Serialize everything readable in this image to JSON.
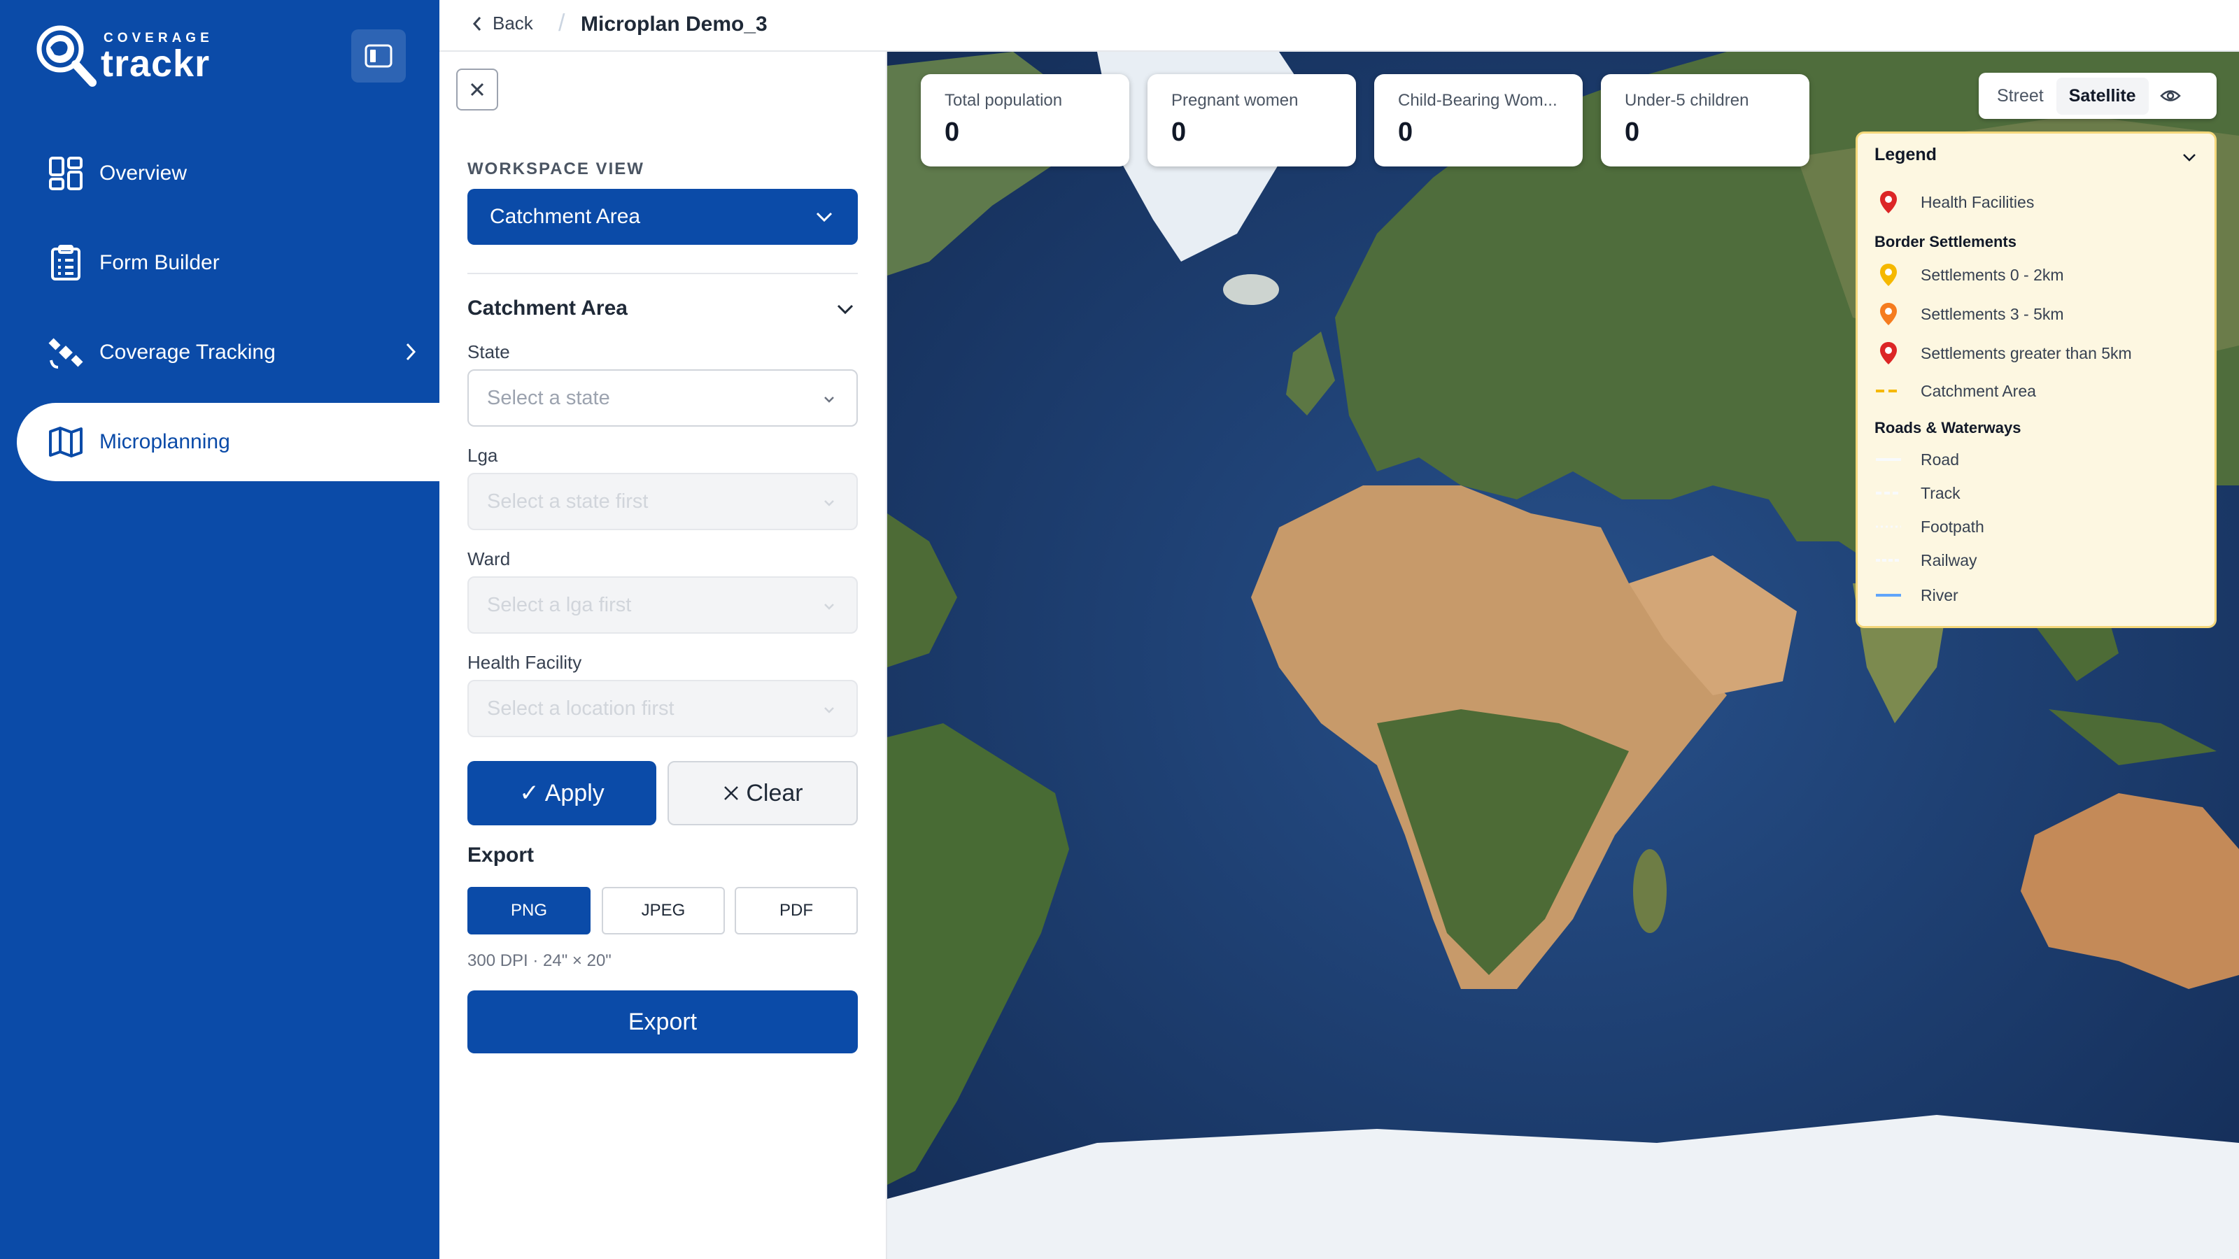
{
  "app": {
    "logo_small": "COVERAGE",
    "logo_big": "trackr"
  },
  "sidebar": {
    "items": [
      {
        "label": "Overview"
      },
      {
        "label": "Form Builder"
      },
      {
        "label": "Coverage Tracking"
      },
      {
        "label": "Microplanning"
      }
    ],
    "active": "Microplanning"
  },
  "header": {
    "back_label": "Back",
    "separator": "/",
    "title": "Microplan Demo_3"
  },
  "panel": {
    "workspace_label": "WORKSPACE VIEW",
    "workspace_value": "Catchment Area",
    "group_title": "Catchment Area",
    "fields": [
      {
        "label": "State",
        "placeholder": "Select a state"
      },
      {
        "label": "Lga",
        "placeholder": "Select a state first"
      },
      {
        "label": "Ward",
        "placeholder": "Select a lga first"
      },
      {
        "label": "Health Facility",
        "placeholder": "Select a location first"
      }
    ],
    "apply_glyph": "✓",
    "apply_label": "Apply",
    "clear_label": "Clear",
    "export_title": "Export",
    "formats": [
      "PNG",
      "JPEG",
      "PDF"
    ],
    "selected_format": "PNG",
    "export_note": "300 DPI · 24\" × 20\"",
    "export_button": "Export"
  },
  "stats": [
    {
      "label": "Total population",
      "value": "0"
    },
    {
      "label": "Pregnant women",
      "value": "0"
    },
    {
      "label": "Child-Bearing Wom...",
      "value": "0"
    },
    {
      "label": "Under-5 children",
      "value": "0"
    }
  ],
  "map_layers": {
    "options": [
      "Street",
      "Satellite"
    ],
    "selected": "Satellite"
  },
  "legend": {
    "title": "Legend",
    "health_facilities": "Health Facilities",
    "border_heading": "Border Settlements",
    "border_items": [
      {
        "label": "Settlements 0 - 2km",
        "color": "#f5b800"
      },
      {
        "label": "Settlements 3 - 5km",
        "color": "#f57c1f"
      },
      {
        "label": "Settlements greater than 5km",
        "color": "#dc2626"
      }
    ],
    "catchment": "Catchment Area",
    "roads_heading": "Roads & Waterways",
    "roads": [
      {
        "label": "Road",
        "color": "#f8fafc"
      },
      {
        "label": "Track",
        "color": "#f8fafc"
      },
      {
        "label": "Footpath",
        "color": "#f8fafc"
      },
      {
        "label": "Railway",
        "color": "#f8fafc"
      },
      {
        "label": "River",
        "color": "#60a5fa"
      }
    ]
  },
  "colors": {
    "brand": "#0b4ba8",
    "health_facility": "#dc2626",
    "catchment": "#f5b800"
  }
}
